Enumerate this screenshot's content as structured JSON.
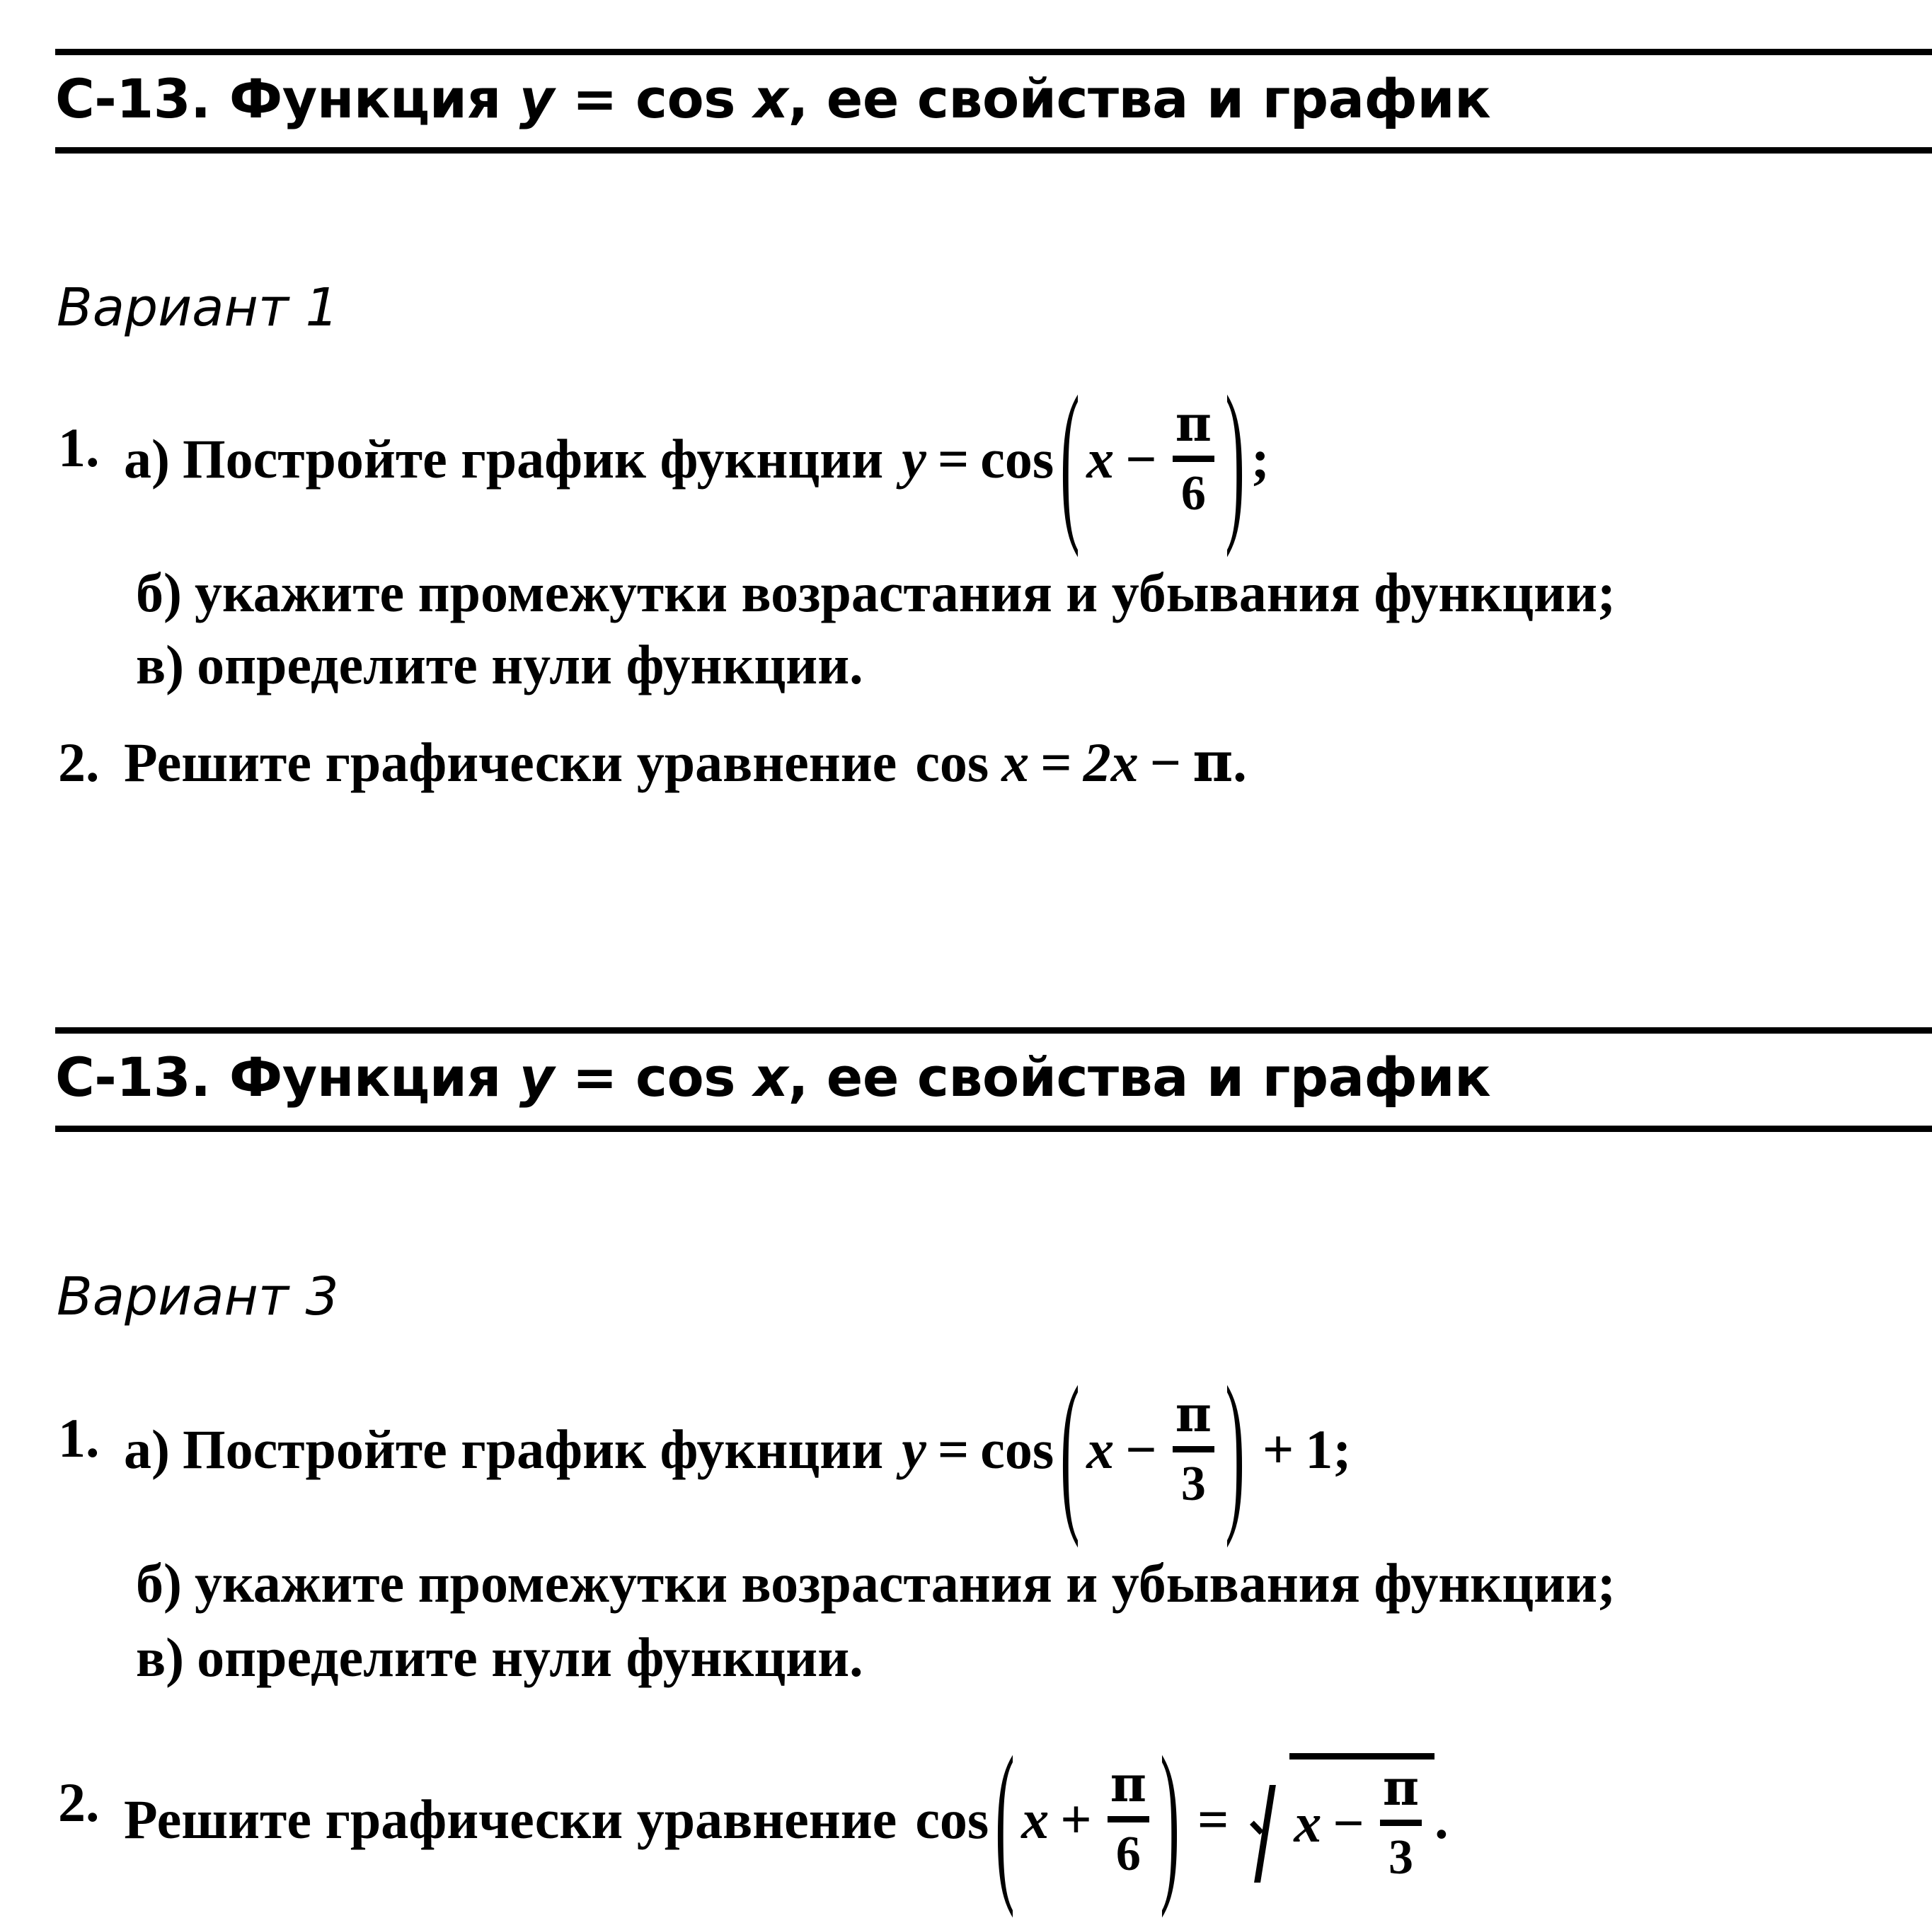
{
  "document": {
    "type": "math-worksheet",
    "language": "ru"
  },
  "sections": [
    {
      "header": {
        "code": "С-13.",
        "title_part1": "Функция",
        "title_var": "y",
        "title_eq": "=",
        "title_cos": "cos",
        "title_x": "x",
        "title_part2": ", ее свойства и график"
      },
      "variant_label": "Вариант 1",
      "tasks": [
        {
          "number": "1.",
          "parts": [
            {
              "marker": "а)",
              "text": "Постройте график фукнции",
              "formula": {
                "lhs": "y",
                "eq": "=",
                "func": "cos",
                "open": "(",
                "arg_var": "x",
                "arg_op": "−",
                "frac_num": "π",
                "frac_den": "6",
                "close": ")",
                "tail": ";"
              }
            },
            {
              "marker": "б)",
              "text": "укажите промежутки возрастания и убывания функции;"
            },
            {
              "marker": "в)",
              "text": "определите нули функции."
            }
          ]
        },
        {
          "number": "2.",
          "parts": [
            {
              "marker": "",
              "text": "Решите графически уравнение",
              "formula_inline": {
                "func": "cos",
                "var": "x",
                "eq": "=",
                "rhs": "2x",
                "op": "−",
                "pi": "π",
                "tail": "."
              }
            }
          ]
        }
      ]
    },
    {
      "header": {
        "code": "С-13.",
        "title_part1": "Функция",
        "title_var": "y",
        "title_eq": "=",
        "title_cos": "cos",
        "title_x": "x",
        "title_part2": ", ее свойства и график"
      },
      "variant_label": "Вариант 3",
      "tasks": [
        {
          "number": "1.",
          "parts": [
            {
              "marker": "а)",
              "text": "Постройте график фукнции",
              "formula": {
                "lhs": "y",
                "eq": "=",
                "func": "cos",
                "open": "(",
                "arg_var": "x",
                "arg_op": "−",
                "frac_num": "π",
                "frac_den": "3",
                "close": ")",
                "plus": "+",
                "one": "1",
                "tail": ";"
              }
            },
            {
              "marker": "б)",
              "text": "укажите промежутки возрастания и убывания функции;"
            },
            {
              "marker": "в)",
              "text": "определите нули функции."
            }
          ]
        },
        {
          "number": "2.",
          "parts": [
            {
              "marker": "",
              "text": "Решите графически уравнение",
              "formula_root": {
                "func": "cos",
                "open": "(",
                "arg_var": "x",
                "arg_op": "+",
                "frac_num": "π",
                "frac_den": "6",
                "close": ")",
                "eq": "=",
                "root_var": "x",
                "root_op": "−",
                "root_num": "π",
                "root_den": "3",
                "tail": "."
              }
            }
          ]
        }
      ]
    }
  ]
}
